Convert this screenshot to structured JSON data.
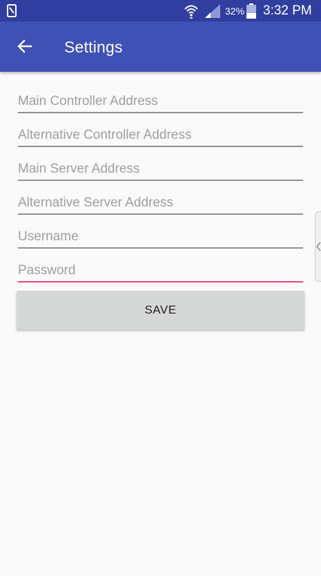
{
  "status_bar": {
    "battery_percent": "32%",
    "time": "3:32 PM",
    "icons": [
      "notification-icon",
      "wifi-icon",
      "signal-icon",
      "battery-icon"
    ]
  },
  "app_bar": {
    "title": "Settings",
    "back_icon": "arrow-back-icon",
    "background_color": "#3f51b5",
    "status_color": "#303f9f"
  },
  "form": {
    "fields": [
      {
        "placeholder": "Main Controller Address",
        "value": ""
      },
      {
        "placeholder": "Alternative Controller Address",
        "value": ""
      },
      {
        "placeholder": "Main Server Address",
        "value": ""
      },
      {
        "placeholder": "Alternative Server Address",
        "value": ""
      },
      {
        "placeholder": "Username",
        "value": ""
      },
      {
        "placeholder": "Password",
        "value": "",
        "focused": true
      }
    ],
    "save_label": "SAVE",
    "accent_color": "#ec407a"
  },
  "edge_panel": {
    "icon": "chevron-left-icon"
  }
}
